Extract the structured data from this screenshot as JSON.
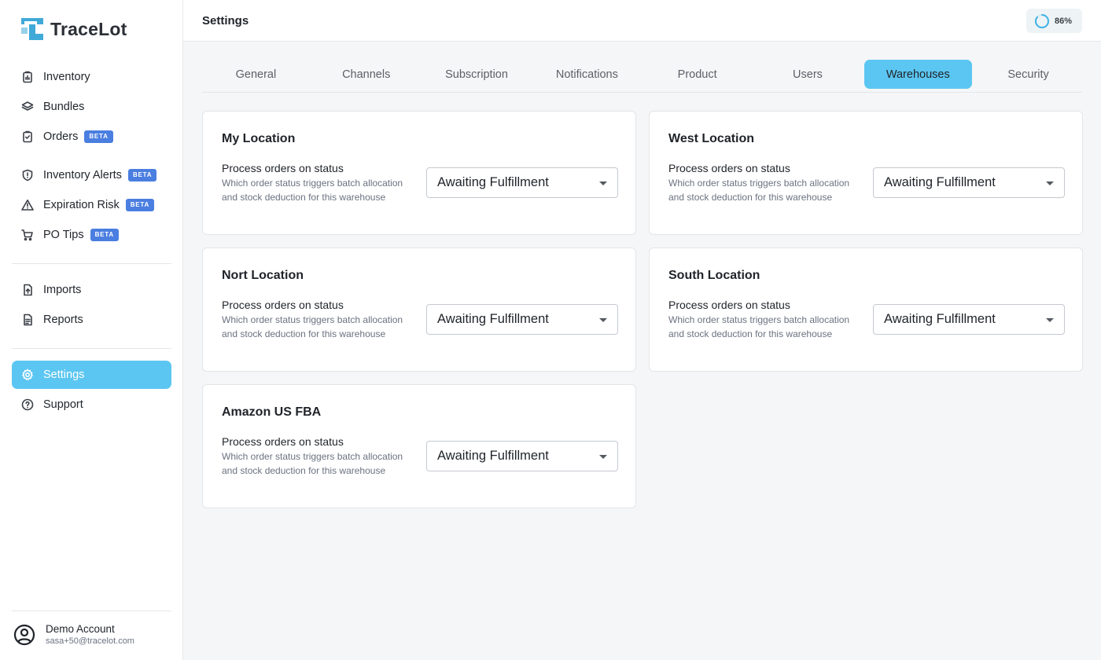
{
  "app": {
    "name": "TraceLot"
  },
  "sidebar": {
    "items": [
      {
        "label": "Inventory",
        "icon": "clipboard-chart-icon",
        "beta": ""
      },
      {
        "label": "Bundles",
        "icon": "layers-icon",
        "beta": ""
      },
      {
        "label": "Orders",
        "icon": "clipboard-check-icon",
        "beta": "BETA"
      },
      {
        "label": "Inventory Alerts",
        "icon": "shield-alert-icon",
        "beta": "BETA"
      },
      {
        "label": "Expiration Risk",
        "icon": "warning-triangle-icon",
        "beta": "BETA"
      },
      {
        "label": "PO Tips",
        "icon": "cart-icon",
        "beta": "BETA"
      },
      {
        "label": "Imports",
        "icon": "file-upload-icon",
        "beta": ""
      },
      {
        "label": "Reports",
        "icon": "file-text-icon",
        "beta": ""
      },
      {
        "label": "Settings",
        "icon": "gear-icon",
        "beta": ""
      },
      {
        "label": "Support",
        "icon": "help-circle-icon",
        "beta": ""
      }
    ],
    "active": "Settings",
    "account": {
      "name": "Demo Account",
      "email": "sasa+50@tracelot.com"
    }
  },
  "header": {
    "title": "Settings",
    "progress": "86%",
    "progress_value": 0.86
  },
  "tabs": {
    "items": [
      "General",
      "Channels",
      "Subscription",
      "Notifications",
      "Product",
      "Users",
      "Warehouses",
      "Security"
    ],
    "active": "Warehouses"
  },
  "warehouses": [
    {
      "name": "My Location",
      "setting_label": "Process orders on status",
      "setting_desc": "Which order status triggers batch allocation and stock deduction for this warehouse",
      "status": "Awaiting Fulfillment"
    },
    {
      "name": "West Location",
      "setting_label": "Process orders on status",
      "setting_desc": "Which order status triggers batch allocation and stock deduction for this warehouse",
      "status": "Awaiting Fulfillment"
    },
    {
      "name": "Nort Location",
      "setting_label": "Process orders on status",
      "setting_desc": "Which order status triggers batch allocation and stock deduction for this warehouse",
      "status": "Awaiting Fulfillment"
    },
    {
      "name": "South Location",
      "setting_label": "Process orders on status",
      "setting_desc": "Which order status triggers batch allocation and stock deduction for this warehouse",
      "status": "Awaiting Fulfillment"
    },
    {
      "name": "Amazon US FBA",
      "setting_label": "Process orders on status",
      "setting_desc": "Which order status triggers batch allocation and stock deduction for this warehouse",
      "status": "Awaiting Fulfillment"
    }
  ],
  "colors": {
    "accent": "#5cc6f2",
    "beta_badge": "#4a7ee0",
    "logo": "#3fa9d8"
  }
}
